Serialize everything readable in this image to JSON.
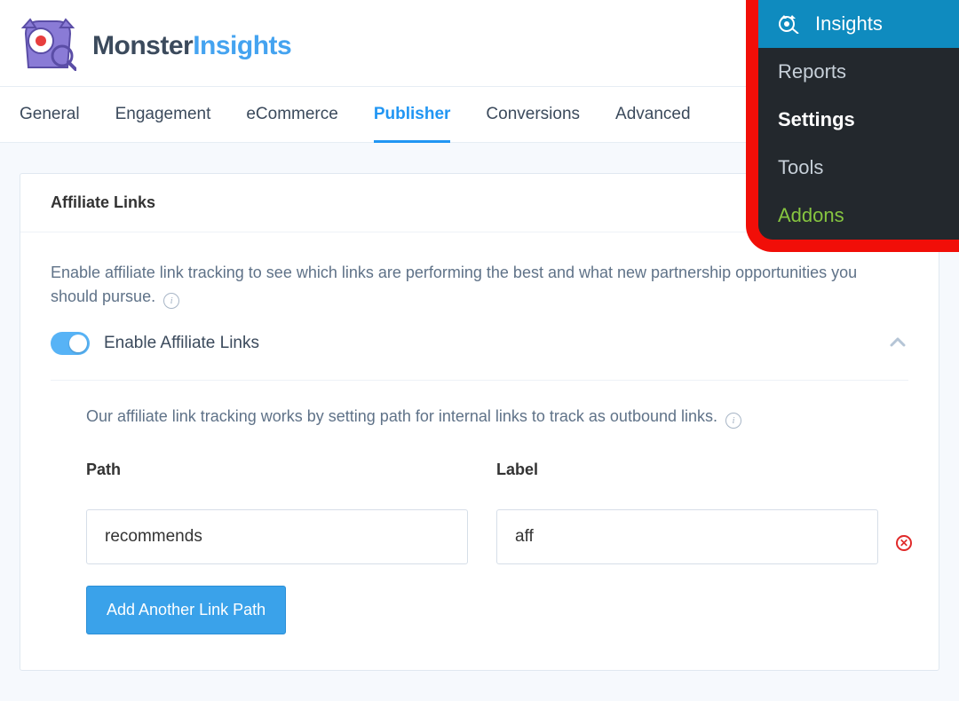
{
  "brand": {
    "part1": "Monster",
    "part2": "Insights"
  },
  "tabs": [
    {
      "label": "General"
    },
    {
      "label": "Engagement"
    },
    {
      "label": "eCommerce"
    },
    {
      "label": "Publisher",
      "active": true
    },
    {
      "label": "Conversions"
    },
    {
      "label": "Advanced"
    }
  ],
  "card": {
    "title": "Affiliate Links",
    "description": "Enable affiliate link tracking to see which links are performing the best and what new partnership opportunities you should pursue.",
    "toggle": {
      "label": "Enable Affiliate Links",
      "value": true
    },
    "sub": {
      "description": "Our affiliate link tracking works by setting path for internal links to track as outbound links.",
      "path_label": "Path",
      "label_label": "Label",
      "paths": [
        {
          "path": "recommends",
          "label": "aff"
        }
      ],
      "add_button": "Add Another Link Path"
    }
  },
  "wp_menu": {
    "top": "Insights",
    "items": [
      {
        "label": "Reports"
      },
      {
        "label": "Settings",
        "active": true
      },
      {
        "label": "Tools"
      },
      {
        "label": "Addons",
        "addon": true
      }
    ]
  }
}
